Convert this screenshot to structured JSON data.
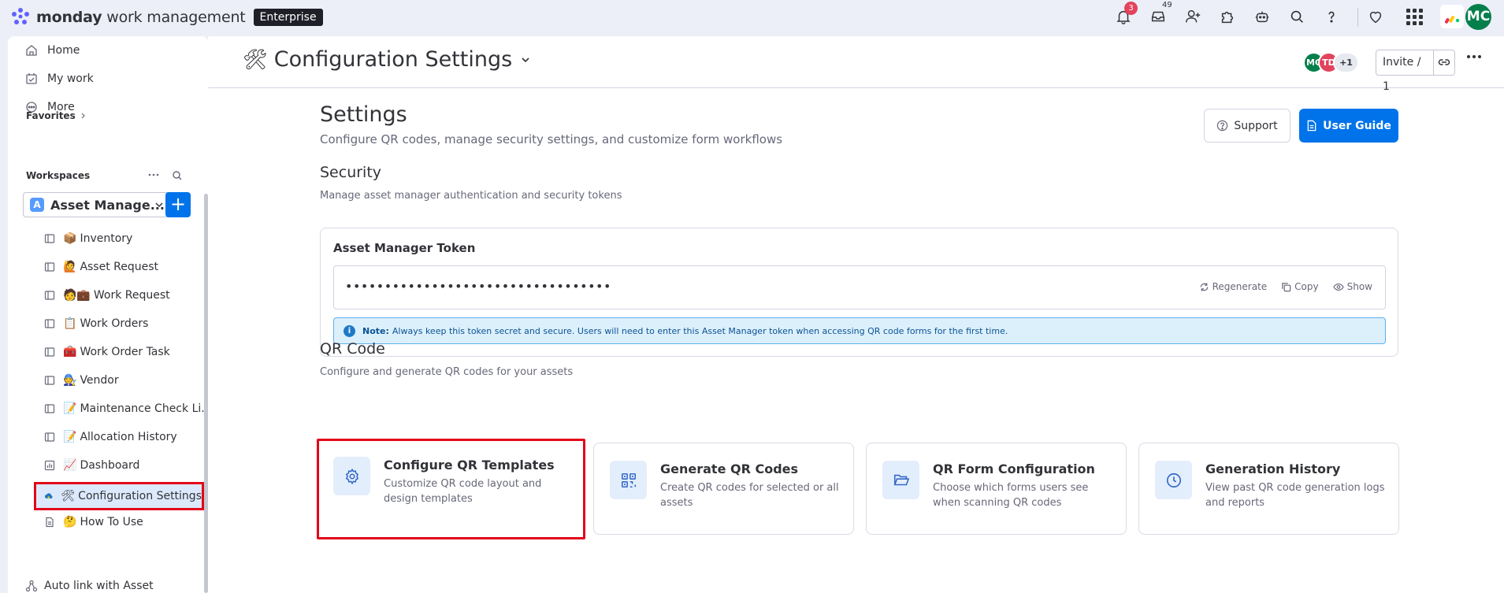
{
  "app": {
    "brand_bold": "monday",
    "brand_rest": " work management",
    "plan_badge": "Enterprise",
    "notifications_count": "3",
    "inbox_count": "49",
    "user_initials": "MC"
  },
  "sidebar": {
    "nav": [
      {
        "label": "Home",
        "icon": "home-icon"
      },
      {
        "label": "My work",
        "icon": "calendar-check-icon"
      },
      {
        "label": "More",
        "icon": "more-circle-icon"
      }
    ],
    "favorites_label": "Favorites",
    "workspaces_label": "Workspaces",
    "workspace_letter": "A",
    "workspace_name": "Asset Manage...",
    "boards": [
      {
        "label": "Inventory",
        "emoji": "📦",
        "icon": "board-icon"
      },
      {
        "label": "Asset Request",
        "emoji": "🙋",
        "icon": "board-icon"
      },
      {
        "label": "Work Request",
        "emoji": "🧑💼",
        "icon": "board-icon"
      },
      {
        "label": "Work Orders",
        "emoji": "📋",
        "icon": "board-icon"
      },
      {
        "label": "Work Order Task",
        "emoji": "🧰",
        "icon": "board-icon"
      },
      {
        "label": "Vendor",
        "emoji": "🧑‍🔧",
        "icon": "board-icon"
      },
      {
        "label": "Maintenance Check Li...",
        "emoji": "📝",
        "icon": "board-icon"
      },
      {
        "label": "Allocation History",
        "emoji": "📝",
        "icon": "board-icon"
      },
      {
        "label": "Dashboard",
        "emoji": "📈",
        "icon": "dashboard-icon"
      },
      {
        "label": "Configuration Settings",
        "emoji": "🛠",
        "icon": "app-icon"
      },
      {
        "label": "How To Use",
        "emoji": "🤔",
        "icon": "doc-icon"
      }
    ],
    "auto_link": "Auto link with Asset"
  },
  "header": {
    "emoji": "🛠",
    "title": "Configuration Settings",
    "avatars": [
      {
        "initials": "MC",
        "color": "#037f4c"
      },
      {
        "initials": "TD",
        "color": "#e2445c"
      },
      {
        "initials": "+1",
        "color": "#e6e9ef"
      }
    ],
    "invite_label": "Invite / 1"
  },
  "page": {
    "title": "Settings",
    "subtitle": "Configure QR codes, manage security settings, and customize form workflows",
    "support_label": "Support",
    "guide_label": "User Guide"
  },
  "security": {
    "title": "Security",
    "subtitle": "Manage asset manager authentication and security tokens",
    "token_label": "Asset Manager Token",
    "token_masked": "••••••••••••••••••••••••••••••••••",
    "regenerate_label": "Regenerate",
    "copy_label": "Copy",
    "show_label": "Show",
    "note_bold": "Note:",
    "note_text": "Always keep this token secret and secure. Users will need to enter this Asset Manager token when accessing QR code forms for the first time."
  },
  "qr": {
    "title": "QR Code",
    "subtitle": "Configure and generate QR codes for your assets",
    "cards": [
      {
        "title": "Configure QR Templates",
        "desc": "Customize QR code layout and design templates",
        "icon": "gear-icon"
      },
      {
        "title": "Generate QR Codes",
        "desc": "Create QR codes for selected or all assets",
        "icon": "qr-icon"
      },
      {
        "title": "QR Form Configuration",
        "desc": "Choose which forms users see when scanning QR codes",
        "icon": "folder-open-icon"
      },
      {
        "title": "Generation History",
        "desc": "View past QR code generation logs and reports",
        "icon": "clock-icon"
      }
    ]
  },
  "colors": {
    "accent": "#0073ea",
    "highlight": "#e2061b",
    "note_bg": "#dcf0fc"
  }
}
